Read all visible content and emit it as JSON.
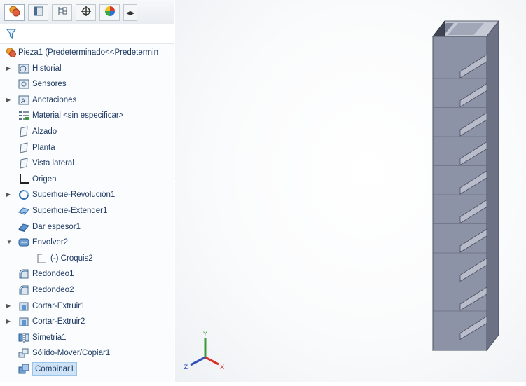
{
  "toolbar": {
    "tabs": [
      {
        "icon": "feature-manager-icon"
      },
      {
        "icon": "property-manager-icon"
      },
      {
        "icon": "configuration-manager-icon"
      },
      {
        "icon": "dimxpert-manager-icon"
      },
      {
        "icon": "display-manager-icon"
      }
    ],
    "scroll_icon": "tab-scroll-arrows-icon"
  },
  "filter": {
    "icon": "filter-icon"
  },
  "tree": {
    "root": {
      "label": "Pieza1  (Predeterminado<<Predetermin",
      "icon": "part-icon"
    },
    "items": [
      {
        "label": "Historial",
        "icon": "history-folder-icon",
        "expandable": true
      },
      {
        "label": "Sensores",
        "icon": "sensors-folder-icon",
        "expandable": false
      },
      {
        "label": "Anotaciones",
        "icon": "annotations-folder-icon",
        "expandable": true
      },
      {
        "label": "Material <sin especificar>",
        "icon": "material-icon",
        "expandable": false
      },
      {
        "label": "Alzado",
        "icon": "plane-icon",
        "expandable": false
      },
      {
        "label": "Planta",
        "icon": "plane-icon",
        "expandable": false
      },
      {
        "label": "Vista lateral",
        "icon": "plane-icon",
        "expandable": false
      },
      {
        "label": "Origen",
        "icon": "origin-icon",
        "expandable": false
      },
      {
        "label": "Superficie-Revolución1",
        "icon": "surface-revolve-icon",
        "expandable": true
      },
      {
        "label": "Superficie-Extender1",
        "icon": "surface-extend-icon",
        "expandable": false
      },
      {
        "label": "Dar espesor1",
        "icon": "thicken-icon",
        "expandable": false
      },
      {
        "label": "Envolver2",
        "icon": "wrap-icon",
        "expandable": true,
        "expanded": true
      },
      {
        "label": "(-) Croquis2",
        "icon": "sketch-icon",
        "expandable": false,
        "child": true
      },
      {
        "label": "Redondeo1",
        "icon": "fillet-icon",
        "expandable": false
      },
      {
        "label": "Redondeo2",
        "icon": "fillet-icon",
        "expandable": false
      },
      {
        "label": "Cortar-Extruir1",
        "icon": "cut-extrude-icon",
        "expandable": true
      },
      {
        "label": "Cortar-Extruir2",
        "icon": "cut-extrude-icon",
        "expandable": true
      },
      {
        "label": "Simetria1",
        "icon": "mirror-icon",
        "expandable": false
      },
      {
        "label": "Sólido-Mover/Copiar1",
        "icon": "move-copy-body-icon",
        "expandable": false
      },
      {
        "label": "Combinar1",
        "icon": "combine-icon",
        "expandable": false,
        "selected": true
      }
    ]
  },
  "viewport": {
    "model": {
      "name": "part-model",
      "color": "#8d93a6",
      "groove_count": 10
    },
    "triad": {
      "x_color": "#d9322b",
      "y_color": "#3a9a3a",
      "z_color": "#2f4fb8",
      "x_label": "X",
      "y_label": "Y",
      "z_label": "Z"
    }
  }
}
